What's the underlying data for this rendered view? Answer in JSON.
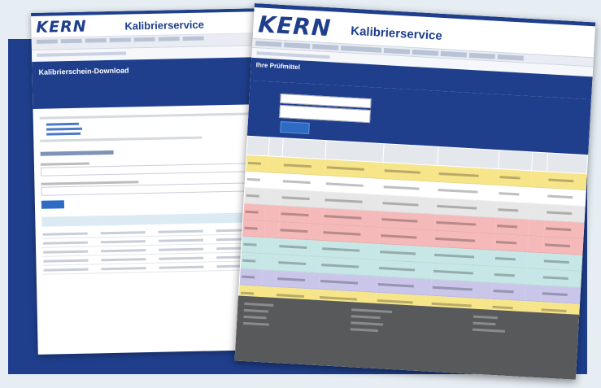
{
  "back_screenshot": {
    "logo": "KERN",
    "title": "Kalibrierservice",
    "banner_heading": "Kalibrierschein-Download"
  },
  "front_screenshot": {
    "logo": "KERN",
    "title": "Kalibrierservice",
    "banner_heading": "Ihre Prüfmittel",
    "row_colors": [
      "#f7e58a",
      "#ffffff",
      "#e7e7e7",
      "#f5b9b9",
      "#f5b9b9",
      "#c7e6e6",
      "#c7e6e6",
      "#c9c6ea",
      "#f7e58a"
    ]
  },
  "colors": {
    "brand_blue": "#1f3f8c",
    "footer_gray": "#58595b",
    "background": "#e6eef4"
  }
}
